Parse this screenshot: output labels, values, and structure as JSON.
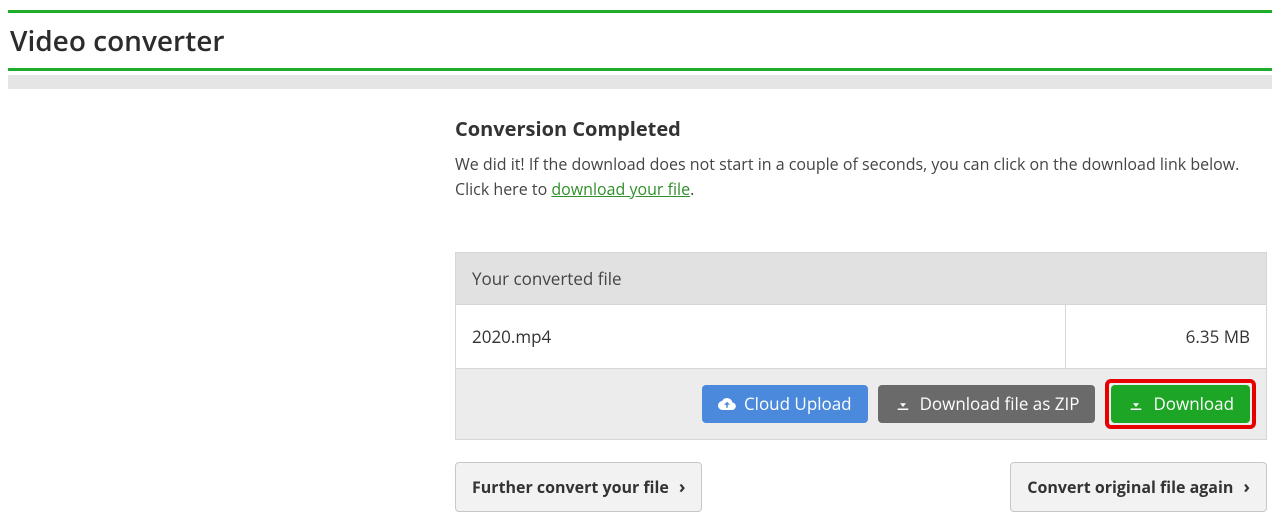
{
  "header": {
    "title": "Video converter"
  },
  "status": {
    "heading": "Conversion Completed",
    "message_pre": "We did it! If the download does not start in a couple of seconds, you can click on the download link below. Click here to ",
    "message_link": "download your file",
    "message_post": "."
  },
  "file_table": {
    "header": "Your converted file",
    "filename": "2020.mp4",
    "filesize": "6.35 MB"
  },
  "buttons": {
    "cloud_upload": "Cloud Upload",
    "download_zip": "Download file as ZIP",
    "download": "Download",
    "further_convert": "Further convert your file",
    "convert_again": "Convert original file again"
  }
}
